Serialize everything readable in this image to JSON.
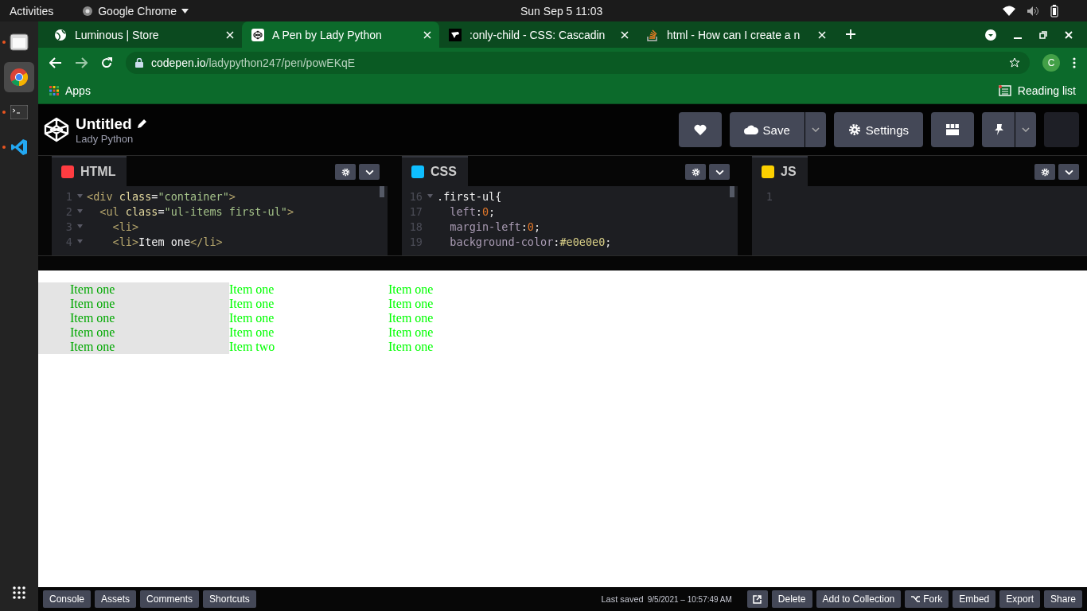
{
  "system_bar": {
    "activities": "Activities",
    "app": "Google Chrome",
    "clock": "Sun Sep 5  11:03"
  },
  "dock": [
    {
      "kind": "files",
      "running": true,
      "selected": false
    },
    {
      "kind": "chrome",
      "running": false,
      "selected": true
    },
    {
      "kind": "terminal",
      "running": true,
      "selected": false
    },
    {
      "kind": "vscode",
      "running": true,
      "selected": false
    }
  ],
  "browser": {
    "tabs": [
      {
        "kind": "globe",
        "title": "Luminous | Store",
        "selected": false
      },
      {
        "kind": "codepen",
        "title": "A Pen by Lady Python",
        "selected": true
      },
      {
        "kind": "mdn",
        "title": ":only-child - CSS: Cascadin",
        "selected": false
      },
      {
        "kind": "stack",
        "title": "html - How can I create a n",
        "selected": false
      }
    ],
    "url_host": "codepen.io",
    "url_path": "/ladypython247/pen/powEKqE",
    "profile": "C",
    "apps": "Apps",
    "reading_list": "Reading list"
  },
  "pen": {
    "title": "Untitled",
    "author": "Lady Python",
    "save": "Save",
    "settings": "Settings"
  },
  "editors": [
    {
      "kind": "html",
      "label": "HTML",
      "lines": [
        {
          "number": "1",
          "fold": true,
          "segments": [
            {
              "kind": "tag",
              "text": "<div "
            },
            {
              "kind": "attr",
              "text": "class"
            },
            {
              "kind": "punct",
              "text": "="
            },
            {
              "kind": "string",
              "text": "\"container\""
            },
            {
              "kind": "tag",
              "text": ">"
            }
          ]
        },
        {
          "number": "2",
          "fold": true,
          "segments": [
            {
              "kind": "tag",
              "text": "  <ul "
            },
            {
              "kind": "attr",
              "text": "class"
            },
            {
              "kind": "punct",
              "text": "="
            },
            {
              "kind": "string",
              "text": "\"ul-items first-ul\""
            },
            {
              "kind": "tag",
              "text": ">"
            }
          ]
        },
        {
          "number": "3",
          "fold": true,
          "segments": [
            {
              "kind": "tag",
              "text": "    <li>"
            }
          ]
        },
        {
          "number": "4",
          "fold": true,
          "segments": [
            {
              "kind": "tag",
              "text": "    <li>"
            },
            {
              "kind": "text",
              "text": "Item one"
            },
            {
              "kind": "tag",
              "text": "</li>"
            }
          ]
        }
      ]
    },
    {
      "kind": "css",
      "label": "CSS",
      "lines": [
        {
          "number": "16",
          "fold": true,
          "segments": [
            {
              "kind": "text",
              "text": ".first-ul{"
            }
          ]
        },
        {
          "number": "17",
          "fold": false,
          "segments": [
            {
              "kind": "prop",
              "text": "  left"
            },
            {
              "kind": "punct",
              "text": ":"
            },
            {
              "kind": "num",
              "text": "0"
            },
            {
              "kind": "punct",
              "text": ";"
            }
          ]
        },
        {
          "number": "18",
          "fold": false,
          "segments": [
            {
              "kind": "prop",
              "text": "  margin-left"
            },
            {
              "kind": "punct",
              "text": ":"
            },
            {
              "kind": "num",
              "text": "0"
            },
            {
              "kind": "punct",
              "text": ";"
            }
          ]
        },
        {
          "number": "19",
          "fold": false,
          "segments": [
            {
              "kind": "prop",
              "text": "  background-color"
            },
            {
              "kind": "punct",
              "text": ":"
            },
            {
              "kind": "color",
              "text": "#e0e0e0"
            },
            {
              "kind": "punct",
              "text": ";"
            }
          ]
        }
      ]
    },
    {
      "kind": "js",
      "label": "JS",
      "lines": [
        {
          "number": "1",
          "fold": false
        }
      ]
    }
  ],
  "preview": {
    "columns": [
      {
        "highlighted": true,
        "items": [
          "Item one",
          "Item one",
          "Item one",
          "Item one",
          "Item one"
        ]
      },
      {
        "highlighted": false,
        "items": [
          "Item one",
          "Item one",
          "Item one",
          "Item one",
          "Item two"
        ]
      },
      {
        "highlighted": false,
        "items": [
          "Item one",
          "Item one",
          "Item one",
          "Item one",
          "Item one"
        ]
      }
    ]
  },
  "footer": {
    "left_buttons": [
      "Console",
      "Assets",
      "Comments",
      "Shortcuts"
    ],
    "last_saved_label": "Last saved",
    "last_saved_time": "9/5/2021 – 10:57:49 AM",
    "right_buttons": [
      {
        "kind": "external"
      },
      {
        "kind": "plain",
        "label": "Delete"
      },
      {
        "kind": "plain",
        "label": "Add to Collection"
      },
      {
        "kind": "fork",
        "label": "Fork"
      },
      {
        "kind": "plain",
        "label": "Embed"
      },
      {
        "kind": "plain",
        "label": "Export"
      },
      {
        "kind": "plain",
        "label": "Share"
      }
    ]
  }
}
